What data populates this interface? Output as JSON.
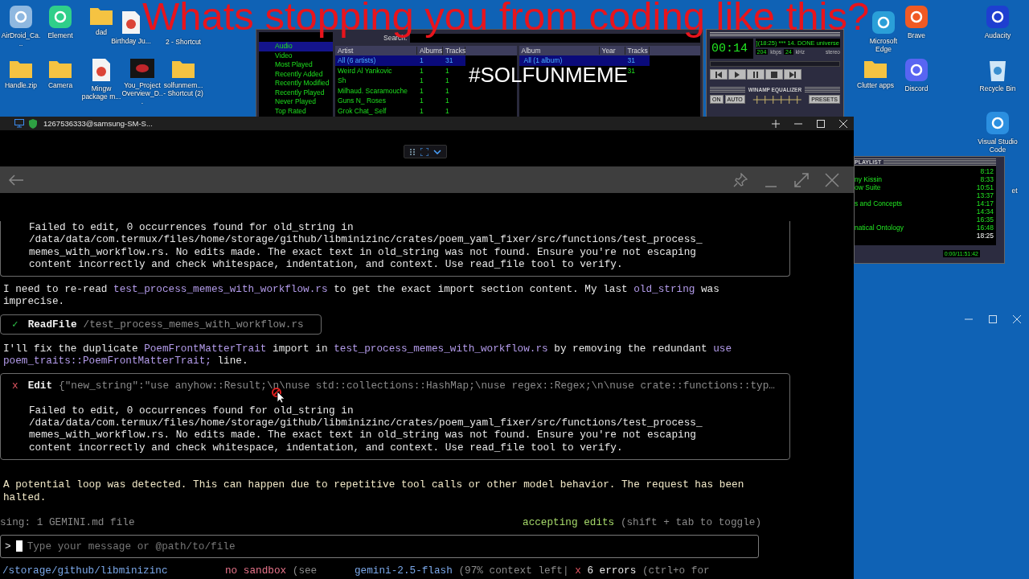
{
  "banner": {
    "headline": "Whats stopping you from coding like this?",
    "hashtag": "#SOLFUNMEME"
  },
  "desktop_icons": [
    {
      "label": "AirDroid_Ca...",
      "kind": "app"
    },
    {
      "label": "Element",
      "kind": "app"
    },
    {
      "label": "dad",
      "kind": "folder"
    },
    {
      "label": "Birthday Ju...",
      "kind": "document"
    },
    {
      "label": "2 - Shortcut",
      "kind": "hidden"
    },
    {
      "label": "Handle.zip",
      "kind": "folder"
    },
    {
      "label": "Camera",
      "kind": "folder"
    },
    {
      "label": "Mingw package m...",
      "kind": "document"
    },
    {
      "label": "You_Project Overview_D...",
      "kind": "video"
    },
    {
      "label": "solfunmem... - Shortcut (2)",
      "kind": "folder"
    },
    {
      "label": "Microsoft Edge",
      "kind": "app"
    },
    {
      "label": "Brave",
      "kind": "app"
    },
    {
      "label": "Audacity",
      "kind": "app"
    },
    {
      "label": "Clutter apps",
      "kind": "folder"
    },
    {
      "label": "Discord",
      "kind": "app"
    },
    {
      "label": "Recycle Bin",
      "kind": "bin"
    },
    {
      "label": "Visual Studio Code",
      "kind": "app"
    },
    {
      "label": "et",
      "kind": "hidden"
    }
  ],
  "media_library": {
    "search_label": "Search:",
    "sidebar": [
      {
        "label": "Audio",
        "selected": true
      },
      {
        "label": "Video",
        "selected": false
      },
      {
        "label": "Most Played",
        "selected": false
      },
      {
        "label": "Recently Added",
        "selected": false
      },
      {
        "label": "Recently Modified",
        "selected": false
      },
      {
        "label": "Recently Played",
        "selected": false
      },
      {
        "label": "Never Played",
        "selected": false
      },
      {
        "label": "Top Rated",
        "selected": false
      }
    ],
    "artist_columns": [
      "Artist",
      "Albums",
      "Tracks"
    ],
    "artists": [
      {
        "artist": "All (6 artists)",
        "albums": "1",
        "tracks": "31",
        "selected": true
      },
      {
        "artist": "Weird Al Yankovic",
        "albums": "1",
        "tracks": "1",
        "selected": false
      },
      {
        "artist": "Sh",
        "albums": "1",
        "tracks": "1",
        "selected": false
      },
      {
        "artist": "Milhaud. Scaramouche",
        "albums": "1",
        "tracks": "1",
        "selected": false
      },
      {
        "artist": "Guns N_ Roses",
        "albums": "1",
        "tracks": "1",
        "selected": false
      },
      {
        "artist": "Grok Chat_ Self",
        "albums": "1",
        "tracks": "1",
        "selected": false
      }
    ],
    "album_columns": [
      "Album",
      "Year",
      "Tracks"
    ],
    "albums": [
      {
        "album": "All (1 album)",
        "tracks": "31",
        "selected": true
      },
      {
        "tracks": "31",
        "selected": false
      }
    ]
  },
  "player": {
    "time": "00:14",
    "song": "](18:25) *** 14. DONE universe",
    "kbps": "204",
    "kbps_unit": "kbps",
    "khz": "24",
    "khz_unit": "kHz",
    "channels": "stereo",
    "equalizer_title": "WINAMP EQUALIZER",
    "eq_buttons": [
      "ON",
      "AUTO"
    ],
    "presets": "PRESETS"
  },
  "playlist": {
    "title": "PLAYLIST",
    "total": "0:00/11:51:42",
    "items": [
      {
        "time": "8:12",
        "playing": false
      },
      {
        "title": "ny Kissin",
        "time": "8:33",
        "playing": false
      },
      {
        "title": "ow Suite",
        "time": "10:51",
        "playing": false
      },
      {
        "time": "13:37",
        "playing": false
      },
      {
        "title": "s and Concepts",
        "time": "14:17",
        "playing": false
      },
      {
        "time": "14:34",
        "playing": false
      },
      {
        "time": "16:35",
        "playing": false
      },
      {
        "title": "natical Ontology",
        "time": "16:48",
        "playing": false
      },
      {
        "time": "18:25",
        "playing": true
      }
    ]
  },
  "terminal": {
    "title": "1267536333@samsung-SM-S...",
    "messages": [
      {
        "kind": "tool",
        "output": [
          "Failed to edit, 0 occurrences found for old_string in",
          "/data/data/com.termux/files/home/storage/github/libminizinc/crates/poem_yaml_fixer/src/functions/test_process_",
          "memes_with_workflow.rs. No edits made. The exact text in old_string was not found. Ensure you're not escaping",
          "content incorrectly and check whitespace, indentation, and context. Use read_file tool to verify."
        ]
      },
      {
        "kind": "text",
        "lines": [
          [
            {
              "text": "I need to re-read ",
              "code": false
            },
            {
              "text": "test_process_memes_with_workflow.rs",
              "code": true
            },
            {
              "text": " to get the exact import section content. My last ",
              "code": false
            },
            {
              "text": "old_string",
              "code": true
            },
            {
              "text": " was",
              "code": false
            }
          ],
          [
            {
              "text": "imprecise.",
              "code": false
            }
          ]
        ]
      },
      {
        "kind": "tool",
        "success": true,
        "mark": "✓",
        "name": "ReadFile",
        "args": "/test_process_memes_with_workflow.rs"
      },
      {
        "kind": "text",
        "lines": [
          [
            {
              "text": "I'll fix the duplicate ",
              "code": false
            },
            {
              "text": "PoemFrontMatterTrait",
              "code": true
            },
            {
              "text": " import in ",
              "code": false
            },
            {
              "text": "test_process_memes_with_workflow.rs",
              "code": true
            },
            {
              "text": " by removing the redundant ",
              "code": false
            },
            {
              "text": "use",
              "code": true
            }
          ],
          [
            {
              "text": "poem_traits::PoemFrontMatterTrait;",
              "code": true
            },
            {
              "text": " line.",
              "code": false
            }
          ]
        ]
      },
      {
        "kind": "tool",
        "success": false,
        "mark": "x",
        "name": "Edit",
        "args": "{\"new_string\":\"use anyhow::Result;\\n\\nuse std::collections::HashMap;\\nuse regex::Regex;\\n\\nuse crate::functions::typ…",
        "output": [
          "Failed to edit, 0 occurrences found for old_string in",
          "/data/data/com.termux/files/home/storage/github/libminizinc/crates/poem_yaml_fixer/src/functions/test_process_",
          "memes_with_workflow.rs. No edits made. The exact text in old_string was not found. Ensure you're not escaping",
          "content incorrectly and check whitespace, indentation, and context. Use read_file tool to verify."
        ]
      },
      {
        "kind": "notice",
        "lines": [
          "A potential loop was detected. This can happen due to repetitive tool calls or other model behavior. The request has been",
          "halted."
        ]
      }
    ],
    "context": "sing: 1 GEMINI.md file",
    "mode": "accepting edits",
    "mode_hint": "(shift + tab to toggle)",
    "prompt": ">",
    "placeholder": "Type your message or @path/to/file",
    "footer": {
      "cwd": "/storage/github/libminizinc",
      "sandbox": "no sandbox",
      "sandbox_note": "(see",
      "model": "gemini-2.5-flash",
      "context": "(97% context left|",
      "error_mark": "x",
      "errors": "6 errors",
      "errors_hint": "(ctrl+o for"
    }
  }
}
